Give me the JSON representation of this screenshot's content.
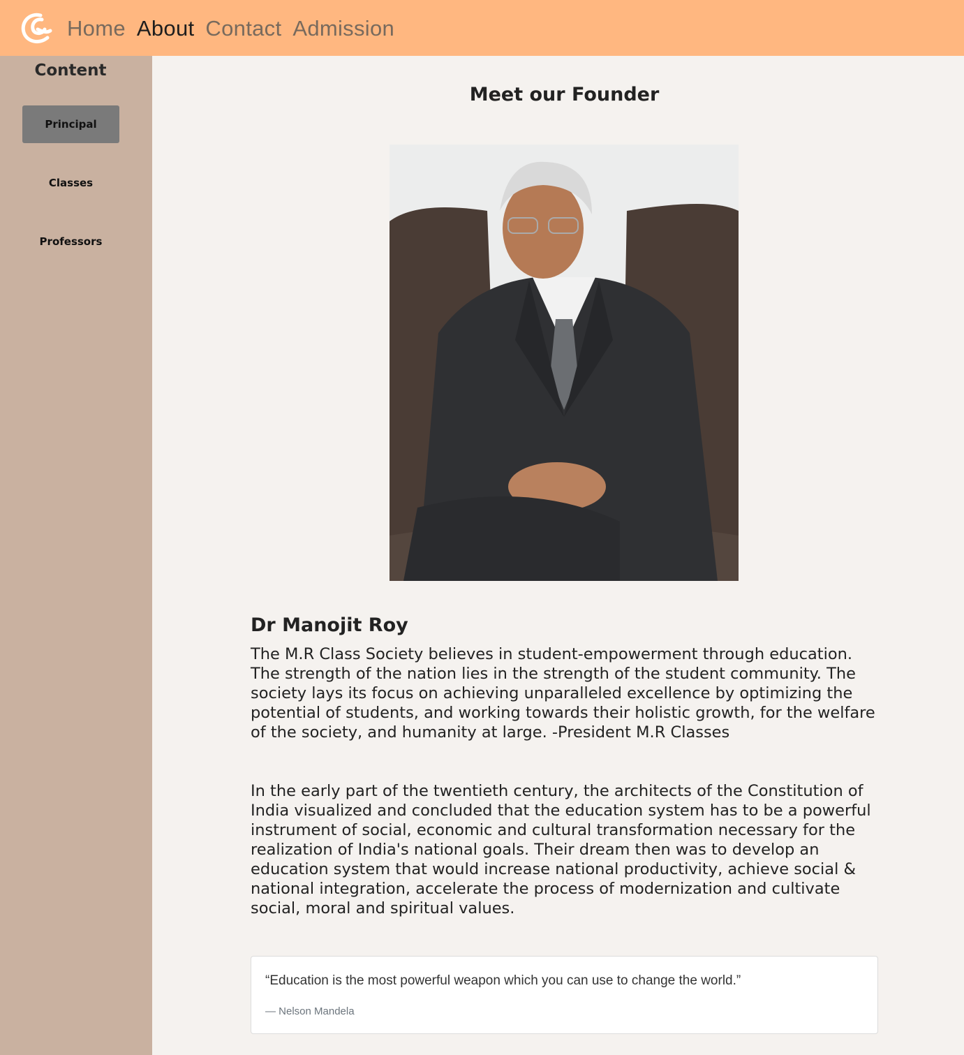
{
  "nav": {
    "logo_icon": "swirl-logo-icon",
    "links": [
      {
        "label": "Home",
        "active": false
      },
      {
        "label": "About",
        "active": true
      },
      {
        "label": "Contact",
        "active": false
      },
      {
        "label": "Admission",
        "active": false
      }
    ]
  },
  "sidebar": {
    "title": "Content",
    "items": [
      {
        "label": "Principal",
        "active": true
      },
      {
        "label": "Classes",
        "active": false
      },
      {
        "label": "Professors",
        "active": false
      }
    ]
  },
  "main": {
    "title": "Meet our Founder",
    "founder_name": "Dr Manojit Roy",
    "paragraph1": "The M.R Class Society believes in student-empowerment through education. The strength of the nation lies in the strength of the student community. The society lays its focus on achieving unparalleled excellence by optimizing the potential of students, and working towards their holistic growth, for the welfare of the society, and humanity at large. -President M.R Classes",
    "paragraph2": "In the early part of the twentieth century, the architects of the Constitution of India visualized and concluded that the education system has to be a powerful instrument of social, economic and cultural transformation necessary for the realization of India's national goals. Their dream then was to develop an education system that would increase national productivity, achieve social & national integration, accelerate the process of modernization and cultivate social, moral and spiritual values.",
    "quote": {
      "text": "“Education is the most powerful weapon which you can use to change the world.”",
      "author": "— Nelson Mandela"
    }
  },
  "colors": {
    "nav_bg": "#ffb780",
    "sidebar_bg": "#c9b1a0",
    "page_bg": "#f5f2ef",
    "active_sidebar_btn": "#7a7a7a"
  }
}
